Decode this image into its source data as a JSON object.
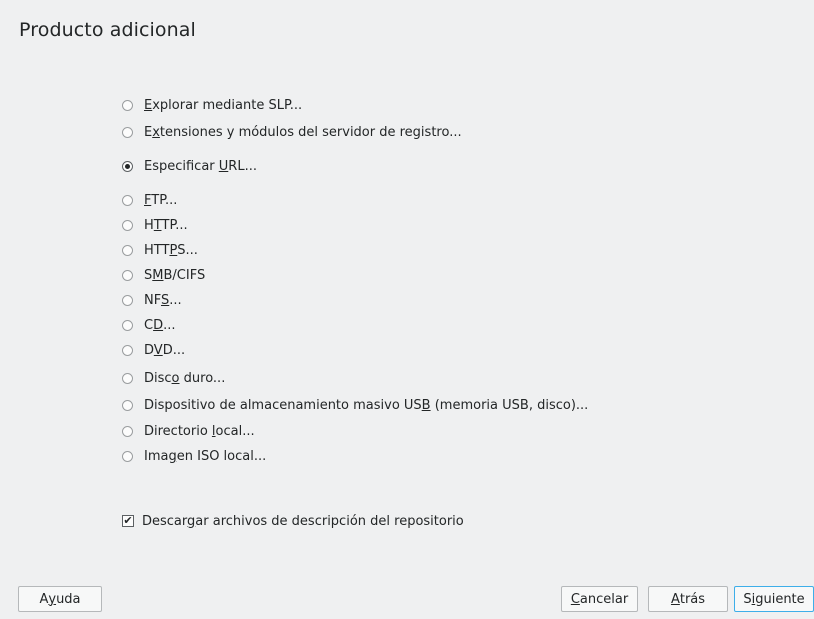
{
  "title": "Producto adicional",
  "options": [
    {
      "pre": "",
      "key": "E",
      "post": "xplorar mediante SLP...",
      "checked": false
    },
    {
      "pre": "E",
      "key": "x",
      "post": "tensiones y módulos del servidor de registro...",
      "checked": false
    },
    {
      "pre": "Especificar ",
      "key": "U",
      "post": "RL...",
      "checked": true
    },
    {
      "pre": "",
      "key": "F",
      "post": "TP...",
      "checked": false
    },
    {
      "pre": "H",
      "key": "T",
      "post": "TP...",
      "checked": false
    },
    {
      "pre": "HTT",
      "key": "P",
      "post": "S...",
      "checked": false
    },
    {
      "pre": "S",
      "key": "M",
      "post": "B/CIFS",
      "checked": false
    },
    {
      "pre": "NF",
      "key": "S",
      "post": "...",
      "checked": false
    },
    {
      "pre": "C",
      "key": "D",
      "post": "...",
      "checked": false
    },
    {
      "pre": "D",
      "key": "V",
      "post": "D...",
      "checked": false
    },
    {
      "pre": "Disc",
      "key": "o",
      "post": " duro...",
      "checked": false
    },
    {
      "pre": "Dispositivo de almacenamiento masivo US",
      "key": "B",
      "post": " (memoria USB, disco)...",
      "checked": false
    },
    {
      "pre": "Directorio ",
      "key": "l",
      "post": "ocal...",
      "checked": false
    },
    {
      "pre": "Ima",
      "key": "g",
      "post": "en ISO local...",
      "checked": false
    }
  ],
  "download_checkbox": {
    "pre": "Descar",
    "key": "g",
    "post": "ar archivos de descripción del repositorio",
    "checked": true,
    "mark": "✔"
  },
  "buttons": {
    "help": {
      "pre": "A",
      "key": "y",
      "post": "uda"
    },
    "cancel": {
      "pre": "",
      "key": "C",
      "post": "ancelar"
    },
    "back": {
      "pre": "",
      "key": "A",
      "post": "trás"
    },
    "next": {
      "pre": "S",
      "key": "i",
      "post": "guiente"
    }
  },
  "colors": {
    "background": "#eff0f1",
    "focus_border": "#3daee9",
    "text": "#232627"
  }
}
